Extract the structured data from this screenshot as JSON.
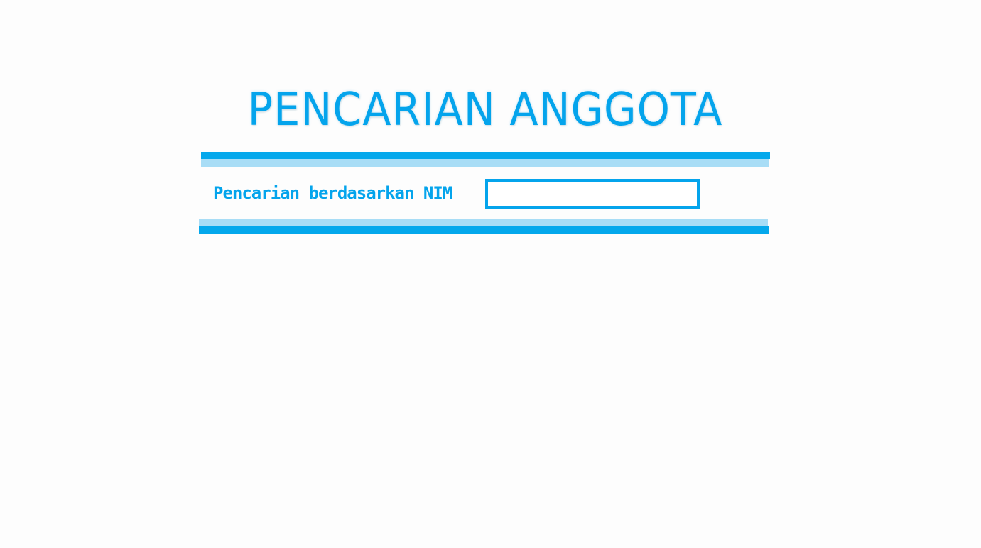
{
  "header": {
    "title": "PENCARIAN ANGGOTA"
  },
  "search": {
    "label": "Pencarian berdasarkan NIM",
    "value": "",
    "placeholder": ""
  },
  "colors": {
    "accent": "#04a4ec",
    "accent_light": "#a8ddf6",
    "background": "#fdfdfd"
  }
}
